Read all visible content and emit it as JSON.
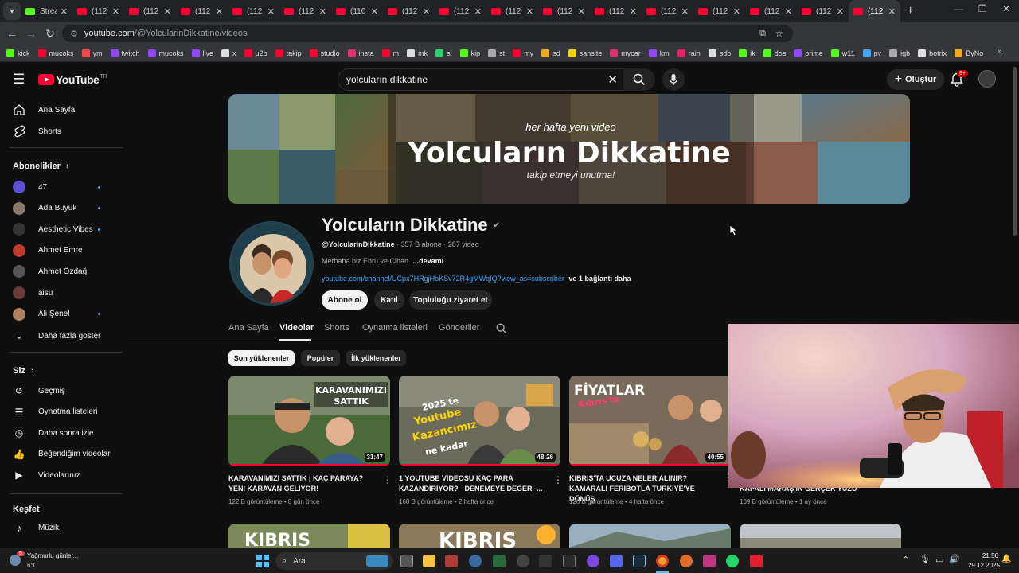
{
  "browser": {
    "tabs": [
      {
        "label": "Strea",
        "kind": "kick"
      },
      {
        "label": "(112",
        "kind": "yt"
      },
      {
        "label": "(112",
        "kind": "yt"
      },
      {
        "label": "(112",
        "kind": "yt"
      },
      {
        "label": "(112",
        "kind": "yt"
      },
      {
        "label": "(112",
        "kind": "yt"
      },
      {
        "label": "(110",
        "kind": "yt"
      },
      {
        "label": "(112",
        "kind": "yt"
      },
      {
        "label": "(112",
        "kind": "yt"
      },
      {
        "label": "(112",
        "kind": "yt"
      },
      {
        "label": "(112",
        "kind": "yt"
      },
      {
        "label": "(112",
        "kind": "yt"
      },
      {
        "label": "(112",
        "kind": "yt"
      },
      {
        "label": "(112",
        "kind": "yt"
      },
      {
        "label": "(112",
        "kind": "yt"
      },
      {
        "label": "(112",
        "kind": "yt"
      },
      {
        "label": "(112",
        "kind": "yt",
        "active": true
      }
    ],
    "new_tab": "+",
    "url_host": "youtube.com",
    "url_path": "/@YolcularinDikkatine/videos",
    "bookmarks": [
      {
        "label": "kick",
        "color": "#53fc18"
      },
      {
        "label": "mucoks",
        "color": "#ff0033"
      },
      {
        "label": "ym",
        "color": "#ff4444"
      },
      {
        "label": "twitch",
        "color": "#9146ff"
      },
      {
        "label": "mucoks",
        "color": "#9146ff"
      },
      {
        "label": "live",
        "color": "#9146ff"
      },
      {
        "label": "x",
        "color": "#dddddd"
      },
      {
        "label": "u2b",
        "color": "#ff0033"
      },
      {
        "label": "takip",
        "color": "#ff0033"
      },
      {
        "label": "studio",
        "color": "#ff0033"
      },
      {
        "label": "insta",
        "color": "#e1306c"
      },
      {
        "label": "m",
        "color": "#ff0033"
      },
      {
        "label": "mk",
        "color": "#dddddd"
      },
      {
        "label": "sl",
        "color": "#25d366"
      },
      {
        "label": "kip",
        "color": "#53fc18"
      },
      {
        "label": "st",
        "color": "#aaaaaa"
      },
      {
        "label": "my",
        "color": "#ff0033"
      },
      {
        "label": "sd",
        "color": "#f5a623"
      },
      {
        "label": "sansite",
        "color": "#f5d20a"
      },
      {
        "label": "mycar",
        "color": "#e1306c"
      },
      {
        "label": "km",
        "color": "#9146ff"
      },
      {
        "label": "rain",
        "color": "#e91e63"
      },
      {
        "label": "sdb",
        "color": "#dddddd"
      },
      {
        "label": "ik",
        "color": "#53fc18"
      },
      {
        "label": "dos",
        "color": "#53fc18"
      },
      {
        "label": "prime",
        "color": "#9146ff"
      },
      {
        "label": "w11",
        "color": "#53fc18"
      },
      {
        "label": "pv",
        "color": "#3ea6ff"
      },
      {
        "label": "igb",
        "color": "#aaaaaa"
      },
      {
        "label": "botrix",
        "color": "#dddddd"
      },
      {
        "label": "ByNo",
        "color": "#f5a623"
      }
    ]
  },
  "youtube": {
    "logo_text": "YouTube",
    "logo_country": "TR",
    "search_value": "yolcuların dikkatine",
    "create_label": "Oluştur",
    "notif_count": "9+",
    "brand_color": "#ff0033"
  },
  "sidebar": {
    "home": "Ana Sayfa",
    "shorts": "Shorts",
    "subs_heading": "Abonelikler",
    "subs": [
      {
        "label": "47",
        "color": "#5b4fd6",
        "dot": true
      },
      {
        "label": "Ada Büyük",
        "color": "#8a7a6a",
        "dot": true
      },
      {
        "label": "Aesthetic Vibes",
        "color": "#333333",
        "dot": true
      },
      {
        "label": "Ahmet Emre",
        "color": "#c0392b",
        "dot": false
      },
      {
        "label": "Ahmet Özdağ",
        "color": "#555555",
        "dot": false
      },
      {
        "label": "aisu",
        "color": "#6b3a3a",
        "dot": false
      },
      {
        "label": "Ali Şenel",
        "color": "#b08060",
        "dot": true
      }
    ],
    "show_more": "Daha fazla göster",
    "you_heading": "Siz",
    "you_items": [
      "Geçmiş",
      "Oynatma listeleri",
      "Daha sonra izle",
      "Beğendiğim videolar",
      "Videolarınız"
    ],
    "explore_heading": "Keşfet",
    "explore_items": [
      "Müzik"
    ]
  },
  "channel": {
    "banner_top": "her hafta yeni video",
    "banner_title": "Yolcuların Dikkatine",
    "banner_bottom": "takip etmeyi unutma!",
    "name": "Yolcuların Dikkatine",
    "handle": "@YolcularinDikkatine",
    "subs": "· 357 B abone",
    "videos": "· 287 video",
    "description": "Merhaba biz Ebru ve Cihan",
    "more": "...devamı",
    "link": "youtube.com/channel/UCpx7HRgjHoKSv72R4gMWqIQ?view_as=subscriber",
    "link_more": "ve 1 bağlantı daha",
    "subscribe": "Abone ol",
    "join": "Katıl",
    "community": "Topluluğu ziyaret et"
  },
  "tabs": [
    "Ana Sayfa",
    "Videolar",
    "Shorts",
    "Oynatma listeleri",
    "Gönderiler"
  ],
  "chips": [
    "Son yüklenenler",
    "Popüler",
    "İlk yüklenenler"
  ],
  "videos": [
    {
      "title": "KARAVANIMIZI SATTIK | KAÇ PARAYA? YENİ KARAVAN GELİYOR!",
      "views": "122 B görüntüleme",
      "ago": "8 gün önce",
      "duration": "31:47",
      "thumb_text": "KARAVANIMIZI SATTIK"
    },
    {
      "title": "1 YOUTUBE VIDEOSU KAÇ PARA KAZANDIRIYOR? - DENEMEYE DEĞER -...",
      "views": "160 B görüntüleme",
      "ago": "2 hafta önce",
      "duration": "48:26",
      "thumb_text": "2025'te Youtube Kazancımız ne kadar"
    },
    {
      "title": "KIBRIS'TA UCUZA NELER ALINIR? KAMARALI FERİBOTLA TÜRKİYE'YE DÖNÜŞ",
      "views": "126 B görüntüleme",
      "ago": "4 hafta önce",
      "duration": "40:55",
      "thumb_text": "FİYATLAR Kıbrıs'ta"
    },
    {
      "title": "KAPALI MARAŞ'IN GERÇEK YÜZÜ",
      "views": "109 B görüntüleme",
      "ago": "1 ay önce",
      "duration": "",
      "thumb_text": ""
    }
  ],
  "row2_thumb_text": [
    "KIBRIS",
    "KIBRIS"
  ],
  "taskbar": {
    "weather": "Yağmurlu günler...",
    "temp": "6°C",
    "weather_badge": "5",
    "search": "Ara",
    "time": "21:56",
    "date": "29.12.2025"
  }
}
